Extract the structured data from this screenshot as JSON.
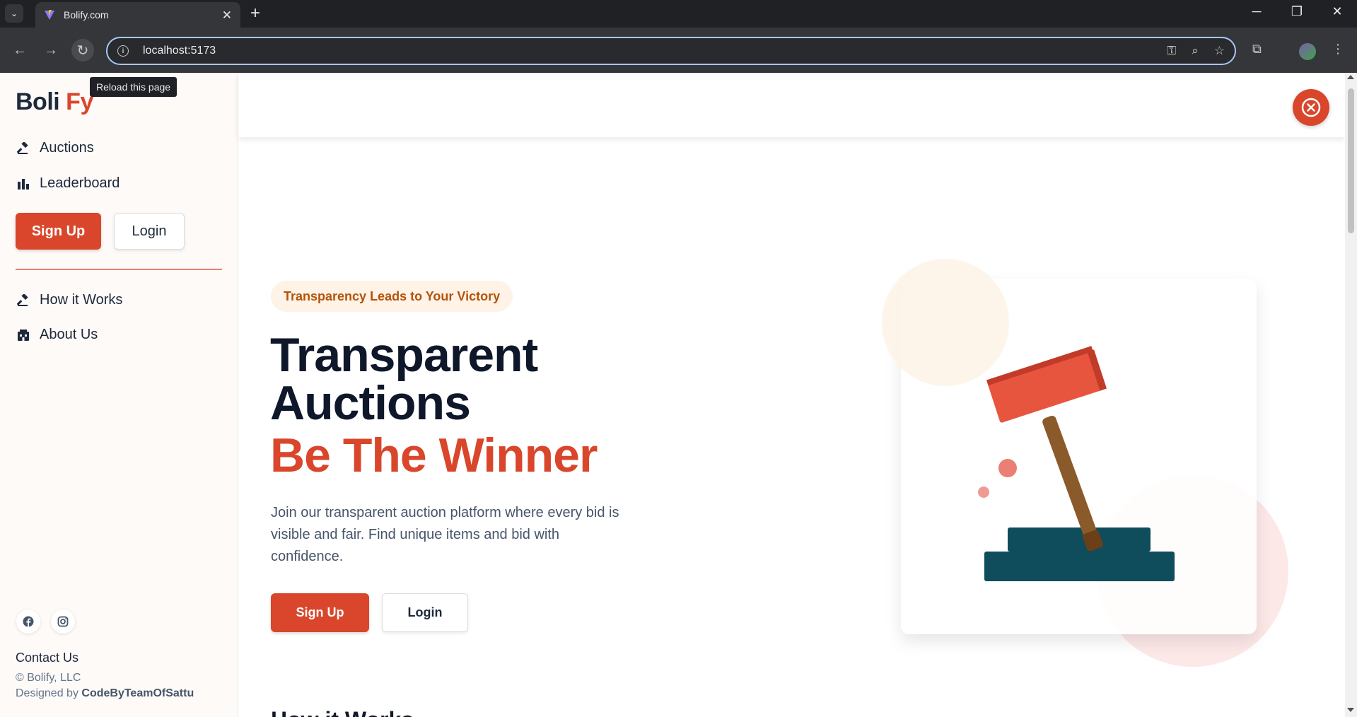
{
  "browser": {
    "tab_title": "Bolify.com",
    "url": "localhost:5173",
    "tooltip": "Reload this page"
  },
  "sidebar": {
    "logo_main": "Boli ",
    "logo_accent": "Fy",
    "nav": [
      {
        "label": "Auctions",
        "icon": "gavel-icon"
      },
      {
        "label": "Leaderboard",
        "icon": "bar-chart-icon"
      }
    ],
    "signup_label": "Sign Up",
    "login_label": "Login",
    "secondary_nav": [
      {
        "label": "How it Works",
        "icon": "gavel-icon"
      },
      {
        "label": "About Us",
        "icon": "building-icon"
      }
    ],
    "contact": "Contact Us",
    "copyright": "© Bolify, LLC",
    "designed_prefix": "Designed by ",
    "designed_by": "CodeByTeamOfSattu"
  },
  "hero": {
    "badge": "Transparency Leads to Your Victory",
    "title_line1": "Transparent",
    "title_line2": "Auctions",
    "accent": "Be The Winner",
    "description": "Join our transparent auction platform where every bid is visible and fair. Find unique items and bid with confidence.",
    "signup_label": "Sign Up",
    "login_label": "Login",
    "next_heading": "How it Works"
  },
  "colors": {
    "brand": "#d9462b",
    "dark": "#0f172a",
    "badge_bg": "#fef3e6",
    "badge_text": "#b45309",
    "gavel_head": "#e8553f",
    "gavel_handle": "#8b5a2b",
    "gavel_base": "#0f4c5c"
  }
}
